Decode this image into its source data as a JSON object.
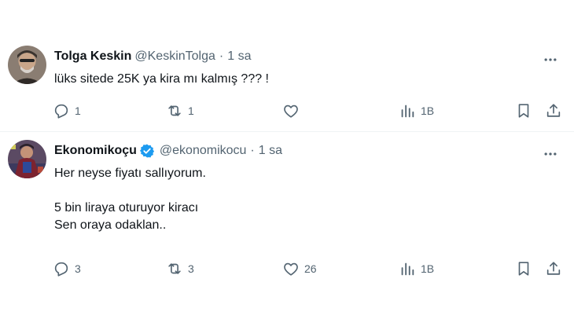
{
  "tweets": [
    {
      "author_name": "Tolga Keskin",
      "handle": "@KeskinTolga",
      "separator": "·",
      "time": "1 sa",
      "verified": false,
      "text": "lüks sitede 25K  ya kira mı kalmış ??? !",
      "replies": "1",
      "retweets": "1",
      "likes": "",
      "views": "1B"
    },
    {
      "author_name": "Ekonomikoçu",
      "handle": "@ekonomikocu",
      "separator": "·",
      "time": "1 sa",
      "verified": true,
      "text": "Her neyse fiyatı sallıyorum.\n\n5 bin liraya oturuyor kiracı\nSen oraya odaklan..",
      "replies": "3",
      "retweets": "3",
      "likes": "26",
      "views": "1B"
    }
  ],
  "colors": {
    "text": "#0f1419",
    "muted": "#536471",
    "verified_blue": "#1d9bf0",
    "divider": "#eff3f4"
  },
  "icons": [
    "reply-icon",
    "retweet-icon",
    "like-icon",
    "views-icon",
    "bookmark-icon",
    "share-icon",
    "more-icon",
    "verified-badge-icon"
  ]
}
